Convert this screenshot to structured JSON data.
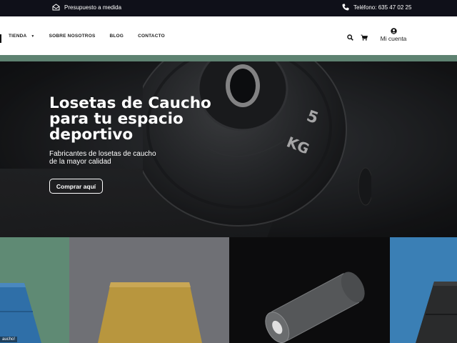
{
  "topbar": {
    "quote_text": "Presupuesto a medida",
    "phone_text": "Teléfono: 635 47 02 25",
    "quote_icon": "envelope-open-icon",
    "phone_icon": "phone-icon"
  },
  "nav": {
    "items": [
      {
        "label": "TIENDA",
        "has_dropdown": true
      },
      {
        "label": "SOBRE NOSOTROS"
      },
      {
        "label": "BLOG"
      },
      {
        "label": "CONTACTO"
      }
    ],
    "account_label": "Mi cuenta",
    "icons": [
      "search-icon",
      "cart-icon",
      "user-icon"
    ]
  },
  "hero": {
    "title": "Losetas de Caucho para tu espacio deportivo",
    "subtitle": "Fabricantes de losetas de caucho de la mayor calidad",
    "button_label": "Comprar aquí",
    "plate_text_top": "5",
    "plate_text_bottom": "KG"
  },
  "tiles": {
    "caption": "aucho!"
  },
  "colors": {
    "topbar_bg": "#0f1019",
    "green_band": "#5e8271",
    "tile_green": "#5f8a74",
    "tile_gray": "#6f7075",
    "tile_black": "#0c0c0d",
    "tile_blue": "#3a7fb5"
  }
}
